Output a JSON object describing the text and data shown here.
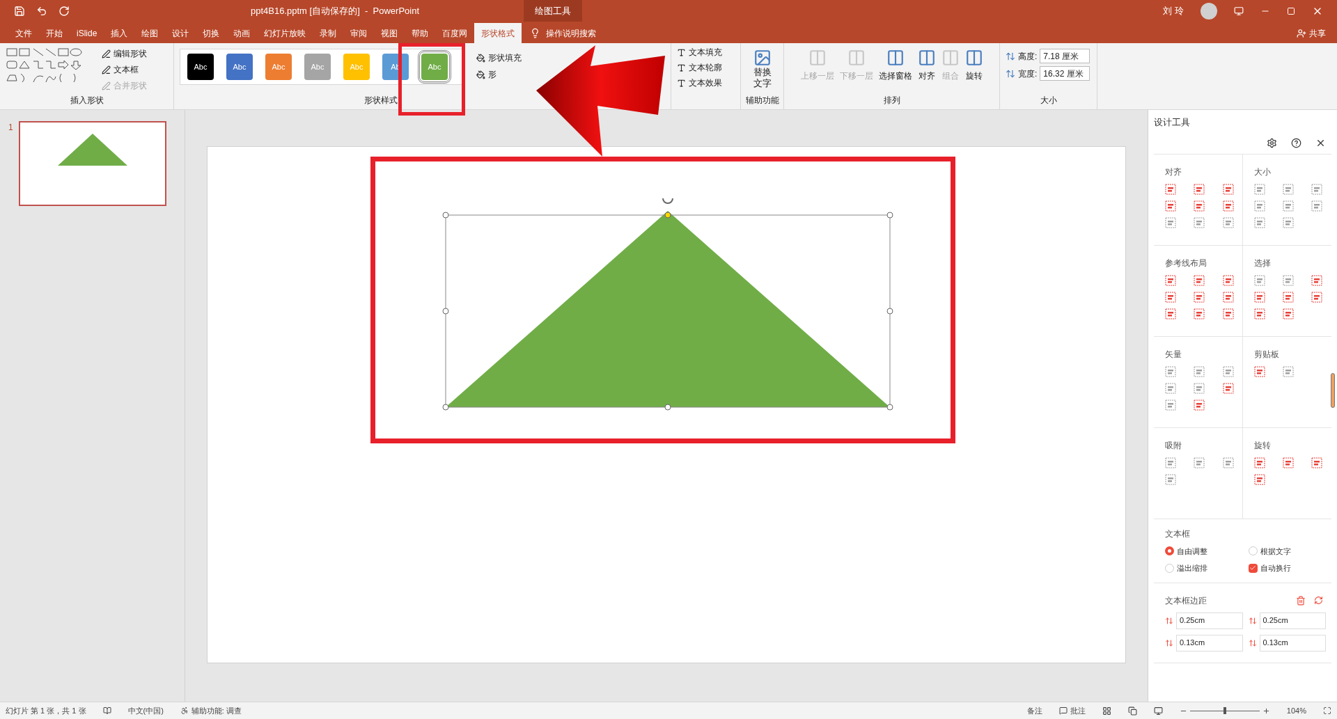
{
  "title_bar": {
    "title": "ppt4B16.pptm [自动保存的]  -  PowerPoint",
    "context_tab": "绘图工具",
    "user": "刘 玲"
  },
  "tabs": [
    {
      "label": "文件",
      "selected": false
    },
    {
      "label": "开始",
      "selected": false
    },
    {
      "label": "iSlide",
      "selected": false
    },
    {
      "label": "插入",
      "selected": false
    },
    {
      "label": "绘图",
      "selected": false
    },
    {
      "label": "设计",
      "selected": false
    },
    {
      "label": "切换",
      "selected": false
    },
    {
      "label": "动画",
      "selected": false
    },
    {
      "label": "幻灯片放映",
      "selected": false
    },
    {
      "label": "录制",
      "selected": false
    },
    {
      "label": "审阅",
      "selected": false
    },
    {
      "label": "视图",
      "selected": false
    },
    {
      "label": "帮助",
      "selected": false
    },
    {
      "label": "百度网",
      "selected": false
    },
    {
      "label": "形状格式",
      "selected": true
    }
  ],
  "tell_me": "操作说明搜索",
  "share": "共享",
  "ribbon": {
    "insert_shapes": {
      "label": "插入形状",
      "buttons": [
        {
          "label": "编辑形状",
          "disabled": false
        },
        {
          "label": "文本框",
          "disabled": false
        },
        {
          "label": "合并形状",
          "disabled": true
        }
      ]
    },
    "shape_styles": {
      "label": "形状样式",
      "swatches": [
        {
          "text": "Abc",
          "color": "#000000",
          "selected": false
        },
        {
          "text": "Abc",
          "color": "#4472c4",
          "selected": false
        },
        {
          "text": "Abc",
          "color": "#ed7d31",
          "selected": false
        },
        {
          "text": "Abc",
          "color": "#a5a5a5",
          "selected": false
        },
        {
          "text": "Abc",
          "color": "#ffc000",
          "selected": false
        },
        {
          "text": "Ab",
          "color": "#5b9bd5",
          "selected": false
        },
        {
          "text": "Abc",
          "color": "#70ad47",
          "selected": true
        }
      ],
      "buttons": [
        "形状填充",
        "形"
      ]
    },
    "wordart": {
      "buttons": [
        "文本填充",
        "文本轮廓",
        "文本效果"
      ]
    },
    "accessibility": {
      "label": "辅助功能",
      "button": "替换文字"
    },
    "arrange": {
      "label": "排列",
      "buttons": [
        {
          "label": "上移一层",
          "disabled": true
        },
        {
          "label": "下移一层",
          "disabled": true
        },
        {
          "label": "选择窗格",
          "disabled": false
        },
        {
          "label": "对齐",
          "disabled": false
        },
        {
          "label": "组合",
          "disabled": true
        },
        {
          "label": "旋转",
          "disabled": false
        }
      ]
    },
    "size": {
      "label": "大小",
      "fields": [
        {
          "label": "高度:",
          "value": "7.18 厘米"
        },
        {
          "label": "宽度:",
          "value": "16.32 厘米"
        }
      ]
    }
  },
  "slides": [
    {
      "number": "1",
      "selected": true
    }
  ],
  "design_panel": {
    "title": "设计工具",
    "sections": [
      {
        "title": "对齐",
        "icons": [
          {
            "disabled": false
          },
          {
            "disabled": false
          },
          {
            "disabled": false
          },
          {
            "disabled": false
          },
          {
            "disabled": false
          },
          {
            "disabled": false
          },
          {
            "disabled": true
          },
          {
            "disabled": true
          },
          {
            "disabled": true
          }
        ]
      },
      {
        "title": "大小",
        "icons": [
          {
            "disabled": true
          },
          {
            "disabled": true
          },
          {
            "disabled": true
          },
          {
            "disabled": true
          },
          {
            "disabled": true
          },
          {
            "disabled": true
          },
          {
            "disabled": true
          },
          {
            "disabled": true
          }
        ]
      },
      {
        "title": "参考线布局",
        "icons": [
          {
            "disabled": false
          },
          {
            "disabled": false
          },
          {
            "disabled": false
          },
          {
            "disabled": false
          },
          {
            "disabled": false
          },
          {
            "disabled": false
          },
          {
            "disabled": false
          },
          {
            "disabled": false
          },
          {
            "disabled": false
          }
        ]
      },
      {
        "title": "选择",
        "icons": [
          {
            "disabled": true
          },
          {
            "disabled": true
          },
          {
            "disabled": false
          },
          {
            "disabled": false
          },
          {
            "disabled": false
          },
          {
            "disabled": false
          },
          {
            "disabled": false
          },
          {
            "disabled": false
          }
        ]
      },
      {
        "title": "矢量",
        "icons": [
          {
            "disabled": true
          },
          {
            "disabled": true
          },
          {
            "disabled": true
          },
          {
            "disabled": true
          },
          {
            "disabled": true
          },
          {
            "disabled": false
          },
          {
            "disabled": true
          },
          {
            "disabled": false
          }
        ]
      },
      {
        "title": "剪贴板",
        "icons": [
          {
            "disabled": false
          },
          {
            "disabled": true
          }
        ]
      },
      {
        "title": "吸附",
        "icons": [
          {
            "disabled": true
          },
          {
            "disabled": true
          },
          {
            "disabled": true
          },
          {
            "disabled": true
          }
        ]
      },
      {
        "title": "旋转",
        "icons": [
          {
            "disabled": false
          },
          {
            "disabled": false
          },
          {
            "disabled": false
          },
          {
            "disabled": false
          }
        ]
      }
    ],
    "textbox": {
      "title": "文本框",
      "options": [
        {
          "kind": "radio",
          "label": "自由调整",
          "selected": true
        },
        {
          "kind": "radio",
          "label": "根据文字",
          "selected": false
        },
        {
          "kind": "radio",
          "label": "溢出缩排",
          "selected": false
        },
        {
          "kind": "checkbox",
          "label": "自动换行",
          "checked": true
        }
      ]
    },
    "margins": {
      "title": "文本框边距",
      "fields": [
        "0.25cm",
        "0.25cm",
        "0.13cm",
        "0.13cm"
      ]
    }
  },
  "status_bar": {
    "slide_info": "幻灯片 第 1 张，共 1 张",
    "language": "中文(中国)",
    "accessibility": "辅助功能: 调查",
    "notes": "备注",
    "comments": "批注",
    "zoom": {
      "level": 0.5,
      "reading": "104%"
    }
  }
}
